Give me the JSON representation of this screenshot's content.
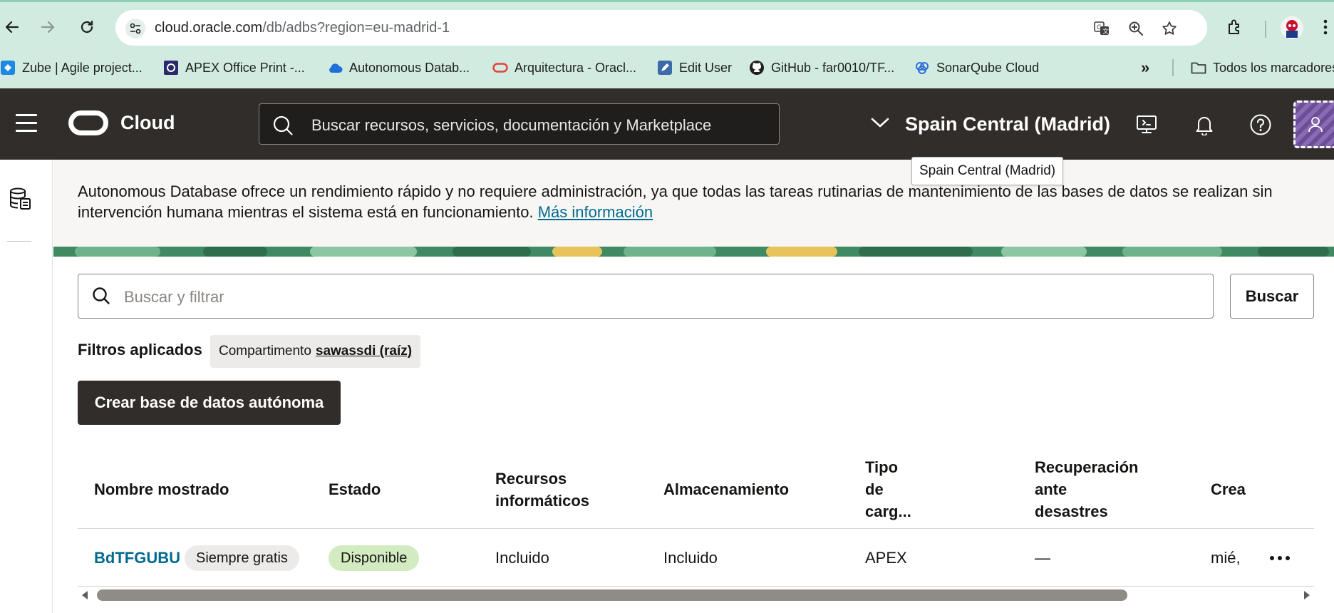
{
  "browser": {
    "url_host": "cloud.oracle.com",
    "url_path": "/db/adbs?region=eu-madrid-1",
    "bookmarks": [
      {
        "label": "Zube | Agile project...",
        "icon": "zube-icon"
      },
      {
        "label": "APEX Office Print -...",
        "icon": "apex-office-print-icon"
      },
      {
        "label": "Autonomous Datab...",
        "icon": "cloud-icon"
      },
      {
        "label": "Arquitectura - Oracl...",
        "icon": "oracle-icon"
      },
      {
        "label": "Edit User",
        "icon": "edit-user-icon"
      },
      {
        "label": "GitHub - far0010/TF...",
        "icon": "github-icon"
      },
      {
        "label": "SonarQube Cloud",
        "icon": "sonarqube-icon"
      }
    ],
    "more_bookmarks": "»",
    "all_bookmarks": "Todos los marcadores"
  },
  "header": {
    "logo_text": "Cloud",
    "search_placeholder": "Buscar recursos, servicios, documentación y Marketplace",
    "region": "Spain Central (Madrid)",
    "region_tooltip": "Spain Central (Madrid)"
  },
  "banner": {
    "text": "Autonomous Database ofrece un rendimiento rápido y no requiere administración, ya que todas las tareas rutinarias de mantenimiento de las bases de datos se realizan sin intervención humana mientras el sistema está en funcionamiento.",
    "link": "Más información"
  },
  "filters": {
    "search_placeholder": "Buscar y filtrar",
    "search_button": "Buscar",
    "applied_label": "Filtros aplicados",
    "chip_key": "Compartimento",
    "chip_value": "sawassdi (raíz)"
  },
  "actions": {
    "create_button": "Crear base de datos autónoma"
  },
  "table": {
    "headers": {
      "name": "Nombre mostrado",
      "state": "Estado",
      "compute_1": "Recursos",
      "compute_2": "informáticos",
      "storage": "Almacenamiento",
      "workload_1": "Tipo",
      "workload_2": "de",
      "workload_3": "carg...",
      "dr_1": "Recuperación",
      "dr_2": "ante",
      "dr_3": "desastres",
      "created": "Crea"
    },
    "rows": [
      {
        "name": "BdTFGUBU",
        "tier_badge": "Siempre gratis",
        "state": "Disponible",
        "compute": "Incluido",
        "storage": "Incluido",
        "workload": "APEX",
        "dr": "—",
        "created": "mié,"
      }
    ]
  },
  "colors": {
    "header_bg": "#312d2a",
    "link": "#006b8f",
    "available_badge": "#d3ebc1",
    "browser_chrome": "#d1ebe0"
  }
}
